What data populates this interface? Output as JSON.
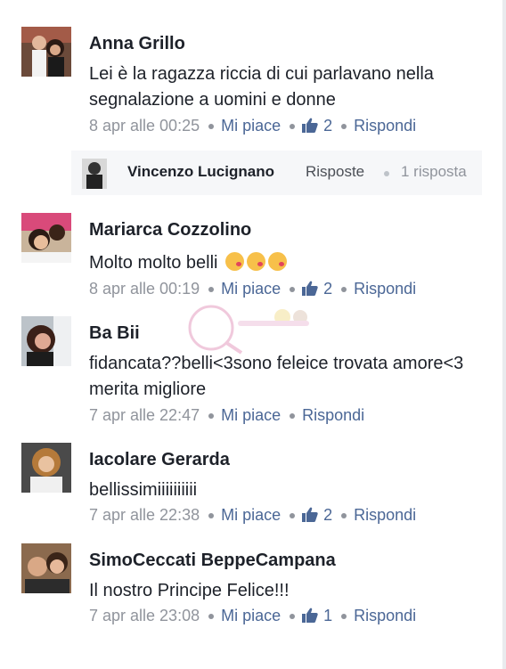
{
  "comments": [
    {
      "author": "Anna Grillo",
      "text": "Lei è la ragazza riccia di cui parlavano nella segnalazione a uomini e donne",
      "time": "8 apr alle 00:25",
      "like_label": "Mi piace",
      "likes": "2",
      "reply_label": "Rispondi",
      "reply": {
        "author": "Vincenzo Lucignano",
        "label": "Risposte",
        "count": "1 risposta"
      }
    },
    {
      "author": "Mariarca Cozzolino",
      "text": "Molto molto belli",
      "emoji": [
        "kiss-emoji",
        "kiss-emoji",
        "kiss-emoji"
      ],
      "time": "8 apr alle 00:19",
      "like_label": "Mi piace",
      "likes": "2",
      "reply_label": "Rispondi"
    },
    {
      "author": "Ba Bii",
      "text": "fidancata??belli<3sono feleice trovata amore<3 merita migliore",
      "time": "7 apr alle 22:47",
      "like_label": "Mi piace",
      "reply_label": "Rispondi"
    },
    {
      "author": "Iacolare Gerarda",
      "text": "bellissimiiiiiiiiii",
      "time": "7 apr alle 22:38",
      "like_label": "Mi piace",
      "likes": "2",
      "reply_label": "Rispondi"
    },
    {
      "author": "SimoCeccati BeppeCampana",
      "text": "Il nostro Principe Felice!!!",
      "time": "7 apr alle 23:08",
      "like_label": "Mi piace",
      "likes": "1",
      "reply_label": "Rispondi"
    }
  ],
  "colors": {
    "link": "#4b6796",
    "meta": "#90949c",
    "text": "#1d2129",
    "reply_bg": "#f6f7f9"
  }
}
